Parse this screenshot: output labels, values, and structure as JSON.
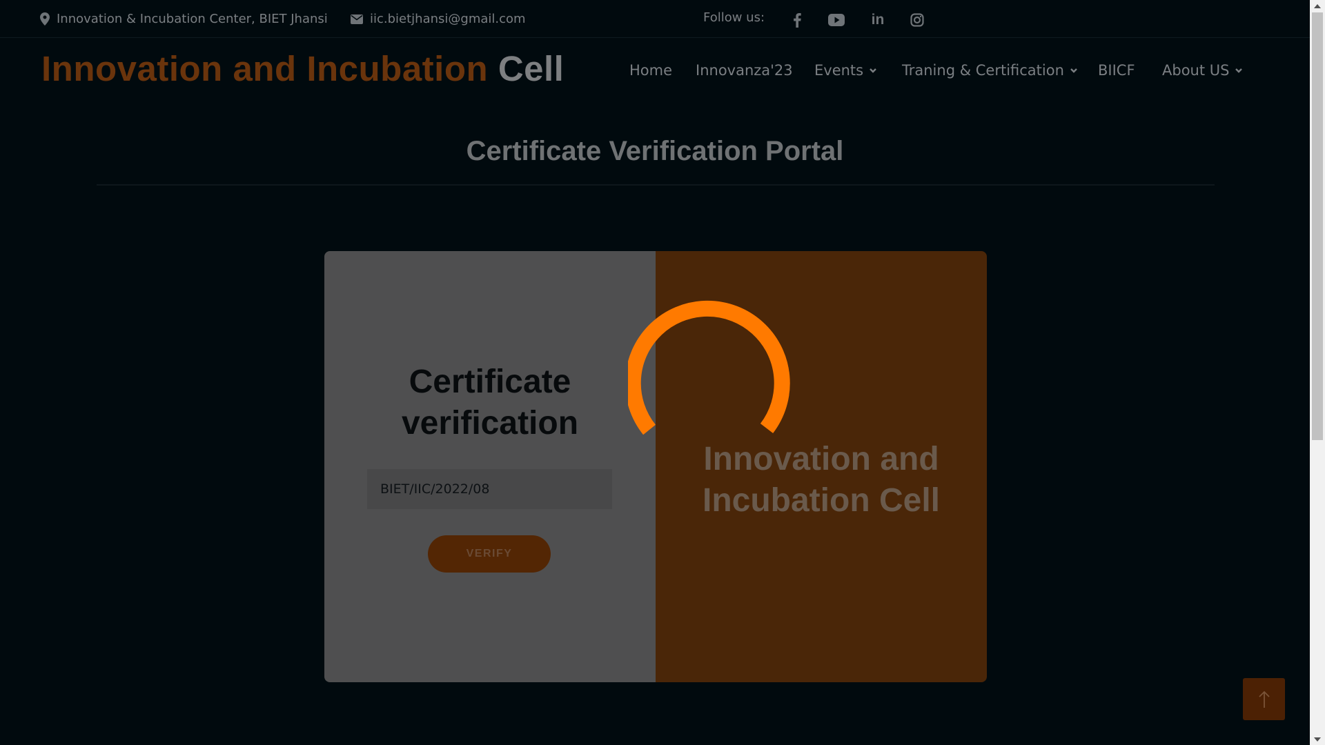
{
  "topbar": {
    "location": "Innovation & Incubation Center, BIET Jhansi",
    "email": "iic.bietjhansi@gmail.com",
    "follow_label": "Follow us:",
    "social": [
      "facebook-icon",
      "youtube-icon",
      "linkedin-icon",
      "instagram-icon"
    ]
  },
  "brand": {
    "orange_part": "Innovation and Incubation",
    "light_part": "Cell"
  },
  "nav": {
    "items": [
      {
        "label": "Home",
        "dropdown": false
      },
      {
        "label": "Innovanza'23",
        "dropdown": false
      },
      {
        "label": "Events",
        "dropdown": true
      },
      {
        "label": "Traning & Certification",
        "dropdown": true
      },
      {
        "label": "BIICF",
        "dropdown": false
      },
      {
        "label": "About US",
        "dropdown": true
      }
    ]
  },
  "page": {
    "title": "Certificate Verification Portal"
  },
  "card": {
    "left": {
      "heading_line1": "Certificate",
      "heading_line2": "verification",
      "input_value": "BIET/IIC/2022/08",
      "verify_label": "VERIFY"
    },
    "right": {
      "heading_line1": "Innovation and",
      "heading_line2": "Incubation Cell"
    }
  },
  "colors": {
    "accent": "#ff7a00",
    "overlay_background": "#010a0e"
  },
  "icons": {
    "scroll_top": "arrow-up-icon",
    "spinner": "loading-spinner"
  }
}
